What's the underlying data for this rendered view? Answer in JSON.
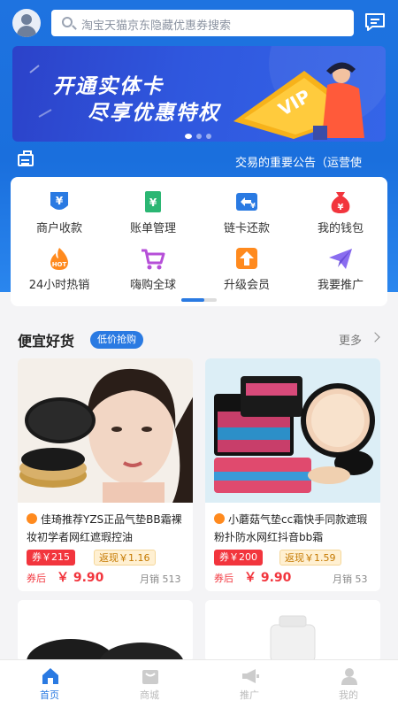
{
  "header": {
    "search_placeholder": "淘宝天猫京东隐藏优惠券搜索"
  },
  "banner": {
    "line1": "开通实体卡",
    "line2": "尽享优惠特权",
    "badge": "VIP",
    "slide_count": 3,
    "active_slide": 1
  },
  "notice": {
    "text": "交易的重要公告（运营使"
  },
  "menu": {
    "items": [
      {
        "label": "商户收款",
        "icon": "yen-shield-icon",
        "color": "#2a7ae2"
      },
      {
        "label": "账单管理",
        "icon": "yen-document-icon",
        "color": "#2bb673"
      },
      {
        "label": "链卡还款",
        "icon": "card-yen-icon",
        "color": "#2a7ae2"
      },
      {
        "label": "我的钱包",
        "icon": "money-bag-icon",
        "color": "#f2353d"
      },
      {
        "label": "24小时热销",
        "icon": "hot-flame-icon",
        "color": "#ff8a1e"
      },
      {
        "label": "嗨购全球",
        "icon": "shopping-cart-icon",
        "color": "#b64fd8"
      },
      {
        "label": "升级会员",
        "icon": "upgrade-arrow-icon",
        "color": "#ff8a1e"
      },
      {
        "label": "我要推广",
        "icon": "paper-plane-icon",
        "color": "#8a6df0"
      }
    ],
    "page_count": 2,
    "active_page": 1
  },
  "section": {
    "title": "便宜好货",
    "tag": "低价抢购",
    "more": "更多"
  },
  "products": [
    {
      "title": "佳琦推荐YZS正品气垫BB霜裸妆初学者网红遮瑕控油",
      "coupon": "券￥215",
      "rebate": "返现￥1.16",
      "after_label": "券后",
      "price": "￥ 9.90",
      "sales": "月销 513"
    },
    {
      "title": "小蘑菇气垫cc霜快手同款遮瑕粉扑防水网红抖音bb霜",
      "coupon": "券￥200",
      "rebate": "返现￥1.59",
      "after_label": "券后",
      "price": "￥ 9.90",
      "sales": "月销 53"
    }
  ],
  "tabbar": {
    "tabs": [
      {
        "label": "首页",
        "active": true
      },
      {
        "label": "商城",
        "active": false
      },
      {
        "label": "推广",
        "active": false
      },
      {
        "label": "我的",
        "active": false
      }
    ]
  },
  "colors": {
    "primary": "#2a7ae2",
    "price_red": "#f2353d",
    "rebate_bg": "#fff0d2"
  }
}
